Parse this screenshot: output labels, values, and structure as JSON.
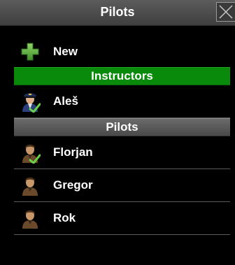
{
  "window": {
    "title": "Pilots"
  },
  "actions": {
    "new_label": "New"
  },
  "sections": [
    {
      "header": "Instructors",
      "color": "#0a8a0a",
      "items": [
        {
          "label": "Aleš",
          "icon": "instructor-pilot-checked-icon"
        }
      ]
    },
    {
      "header": "Pilots",
      "color": "#555555",
      "items": [
        {
          "label": "Florjan",
          "icon": "pilot-checked-icon"
        },
        {
          "label": "Gregor",
          "icon": "pilot-icon"
        },
        {
          "label": "Rok",
          "icon": "pilot-icon"
        }
      ]
    }
  ]
}
